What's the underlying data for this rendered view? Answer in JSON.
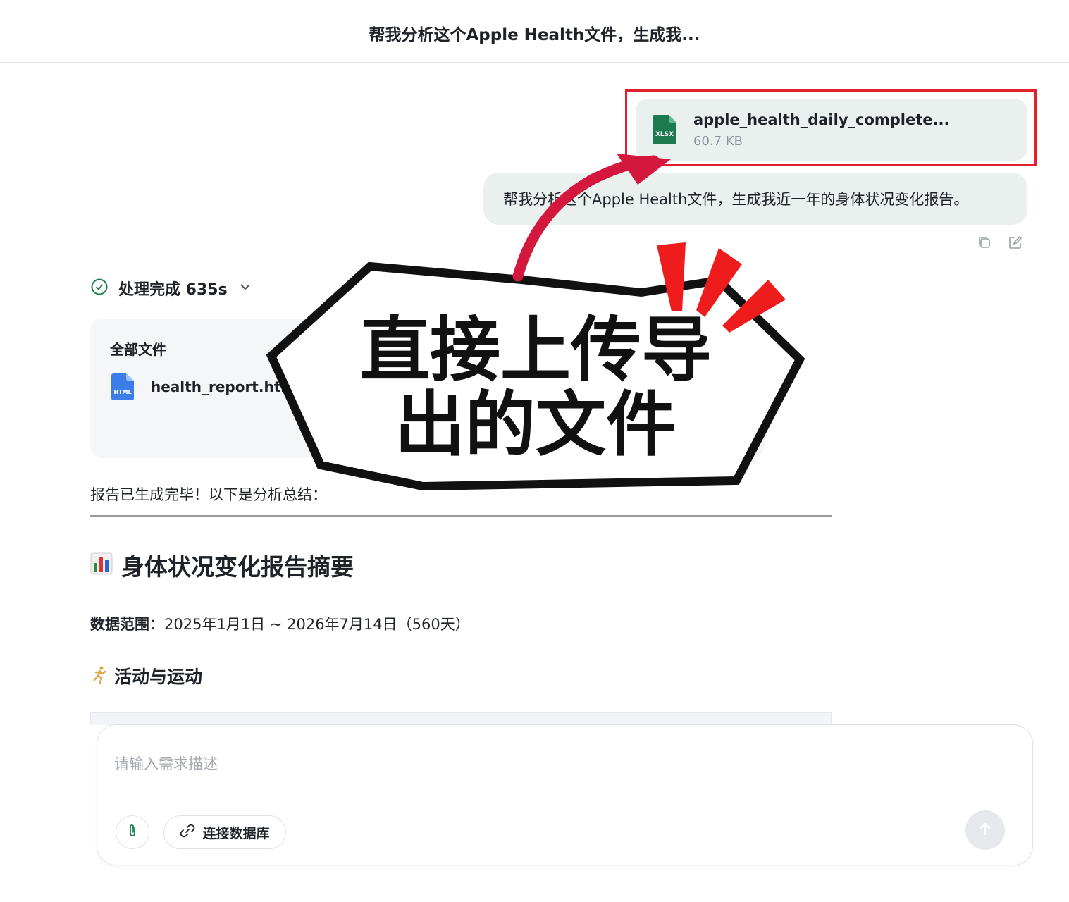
{
  "header": {
    "title": "帮我分析这个Apple Health文件，生成我..."
  },
  "attachment": {
    "type_label": "XLSX",
    "name": "apple_health_daily_complete...",
    "size": "60.7 KB"
  },
  "user_message": {
    "text": "帮我分析这个Apple Health文件，生成我近一年的身体状况变化报告。"
  },
  "status": {
    "text": "处理完成 635s"
  },
  "files_panel": {
    "title": "全部文件",
    "files": [
      {
        "type_label": "HTML",
        "name": "health_report.html"
      }
    ]
  },
  "response": {
    "intro": "报告已生成完毕！以下是分析总结：",
    "heading": "身体状况变化报告摘要",
    "range_label": "数据范围",
    "range_value": "：2025年1月1日 ~ 2026年7月14日（560天）",
    "section_heading": "活动与运动"
  },
  "composer": {
    "placeholder": "请输入需求描述",
    "db_button_label": "连接数据库"
  },
  "annotation": {
    "line1": "直接上传导",
    "line2": "出的文件"
  },
  "colors": {
    "accent_green": "#1a7f4b",
    "highlight_red": "#e0202a",
    "bubble_bg": "#eaf0ed"
  }
}
